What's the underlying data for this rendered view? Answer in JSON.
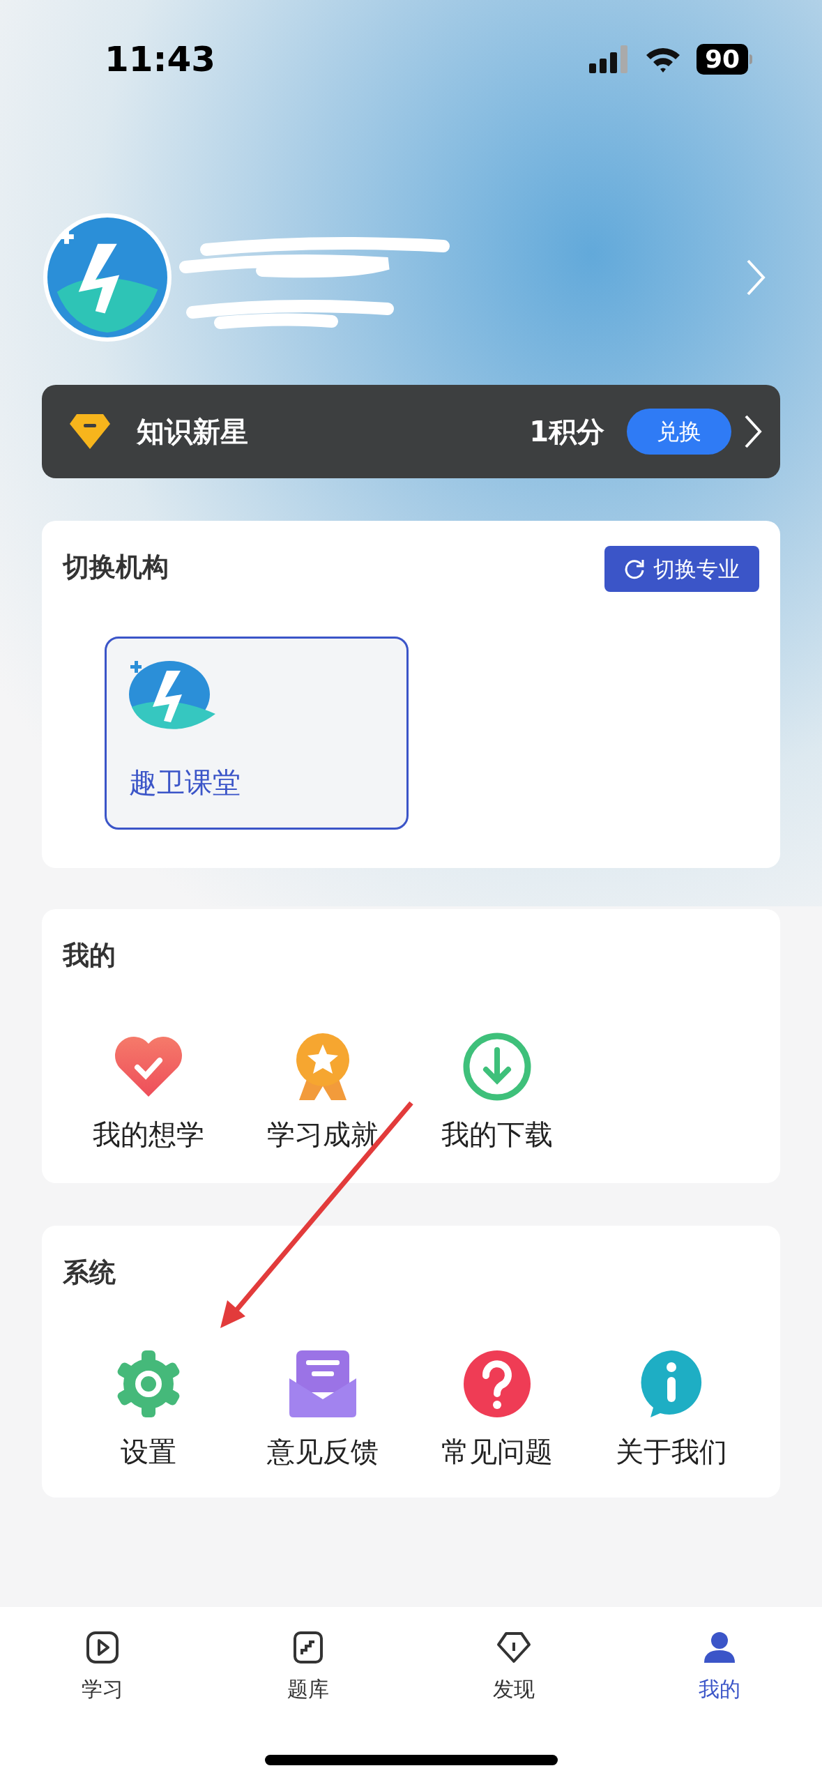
{
  "status_bar": {
    "time": "11:43",
    "battery": "90"
  },
  "membership": {
    "rank_name": "知识新星",
    "points": "1积分",
    "exchange_button": "兑换"
  },
  "institution_section": {
    "title": "切换机构",
    "switch_button": "切换专业",
    "institutions": [
      {
        "name": "趣卫课堂",
        "selected": true
      }
    ]
  },
  "my_section": {
    "title": "我的",
    "items": [
      {
        "label": "我的想学"
      },
      {
        "label": "学习成就"
      },
      {
        "label": "我的下载"
      }
    ]
  },
  "system_section": {
    "title": "系统",
    "items": [
      {
        "label": "设置"
      },
      {
        "label": "意见反馈"
      },
      {
        "label": "常见问题"
      },
      {
        "label": "关于我们"
      }
    ]
  },
  "tab_bar": [
    {
      "label": "学习",
      "selected": false
    },
    {
      "label": "题库",
      "selected": false
    },
    {
      "label": "发现",
      "selected": false
    },
    {
      "label": "我的",
      "selected": true
    }
  ]
}
